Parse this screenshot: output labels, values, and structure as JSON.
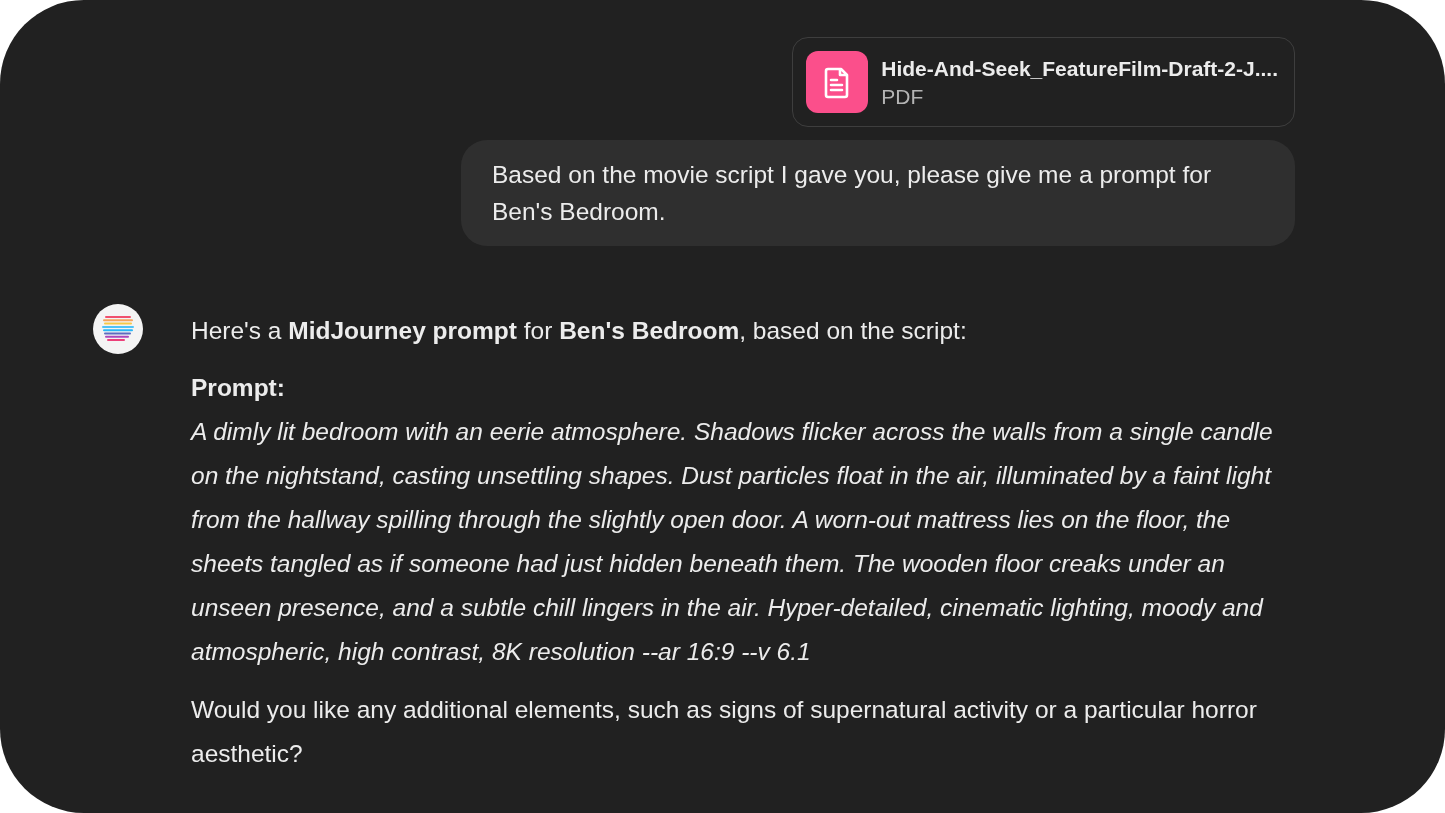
{
  "attachment": {
    "file_name": "Hide-And-Seek_FeatureFilm-Draft-2-J....",
    "file_type": "PDF"
  },
  "user_message": "Based on the movie script I gave you, please give me a prompt for Ben's Bedroom.",
  "assistant_message": {
    "intro": "Here's a **MidJourney prompt** for **Ben's Bedroom**, based on the script:",
    "prompt_label": "Prompt:",
    "prompt_text": "A dimly lit bedroom with an eerie atmosphere. Shadows flicker across the walls from a single candle on the nightstand, casting unsettling shapes. Dust particles float in the air, illuminated by a faint light from the hallway spilling through the slightly open door. A worn-out mattress lies on the floor, the sheets tangled as if someone had just hidden beneath them. The wooden floor creaks under an unseen presence, and a subtle chill lingers in the air. Hyper-detailed, cinematic lighting, moody and atmospheric, high contrast, 8K resolution --ar 16:9 --v 6.1",
    "follow_up": "Would you like any additional elements, such as signs of supernatural activity or a particular horror aesthetic?"
  }
}
